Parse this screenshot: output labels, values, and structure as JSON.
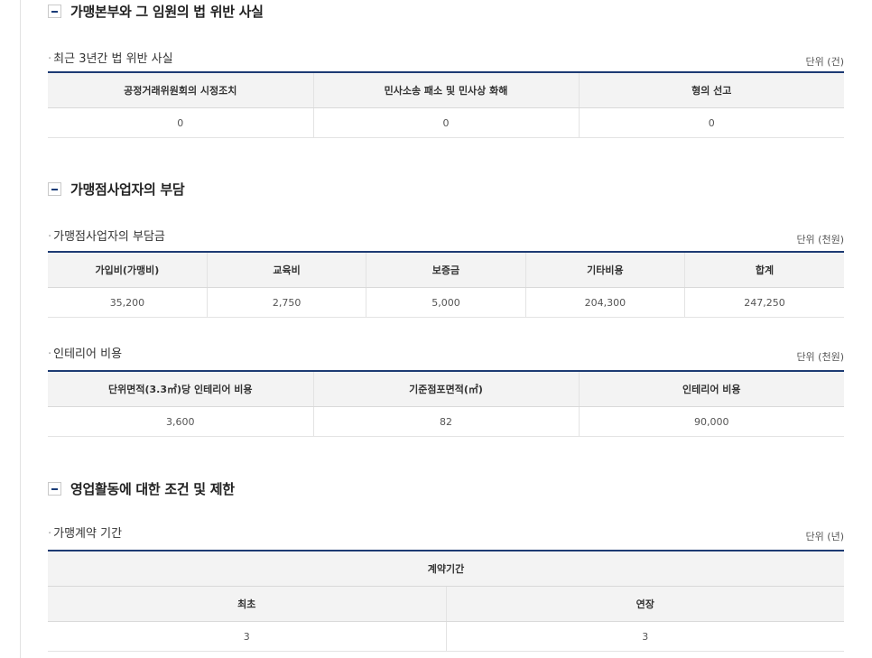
{
  "sections": [
    {
      "title": "가맹본부와 그 임원의 법 위반 사실",
      "subsections": [
        {
          "title": "최근 3년간 법 위반 사실",
          "unit": "단위 (건)",
          "headers": [
            "공정거래위원회의 시정조치",
            "민사소송 패소 및 민사상 화해",
            "형의 선고"
          ],
          "rows": [
            [
              "0",
              "0",
              "0"
            ]
          ]
        }
      ]
    },
    {
      "title": "가맹점사업자의 부담",
      "subsections": [
        {
          "title": "가맹점사업자의 부담금",
          "unit": "단위 (천원)",
          "headers": [
            "가입비(가맹비)",
            "교육비",
            "보증금",
            "기타비용",
            "합계"
          ],
          "rows": [
            [
              "35,200",
              "2,750",
              "5,000",
              "204,300",
              "247,250"
            ]
          ]
        },
        {
          "title": "인테리어 비용",
          "unit": "단위 (천원)",
          "headers": [
            "단위면적(3.3㎡)당 인테리어 비용",
            "기준점포면적(㎡)",
            "인테리어 비용"
          ],
          "rows": [
            [
              "3,600",
              "82",
              "90,000"
            ]
          ]
        }
      ]
    },
    {
      "title": "영업활동에 대한 조건 및 제한",
      "subsections": [
        {
          "title": "가맹계약 기간",
          "unit": "단위 (년)",
          "group_header": "계약기간",
          "headers": [
            "최초",
            "연장"
          ],
          "rows": [
            [
              "3",
              "3"
            ]
          ]
        }
      ]
    }
  ]
}
